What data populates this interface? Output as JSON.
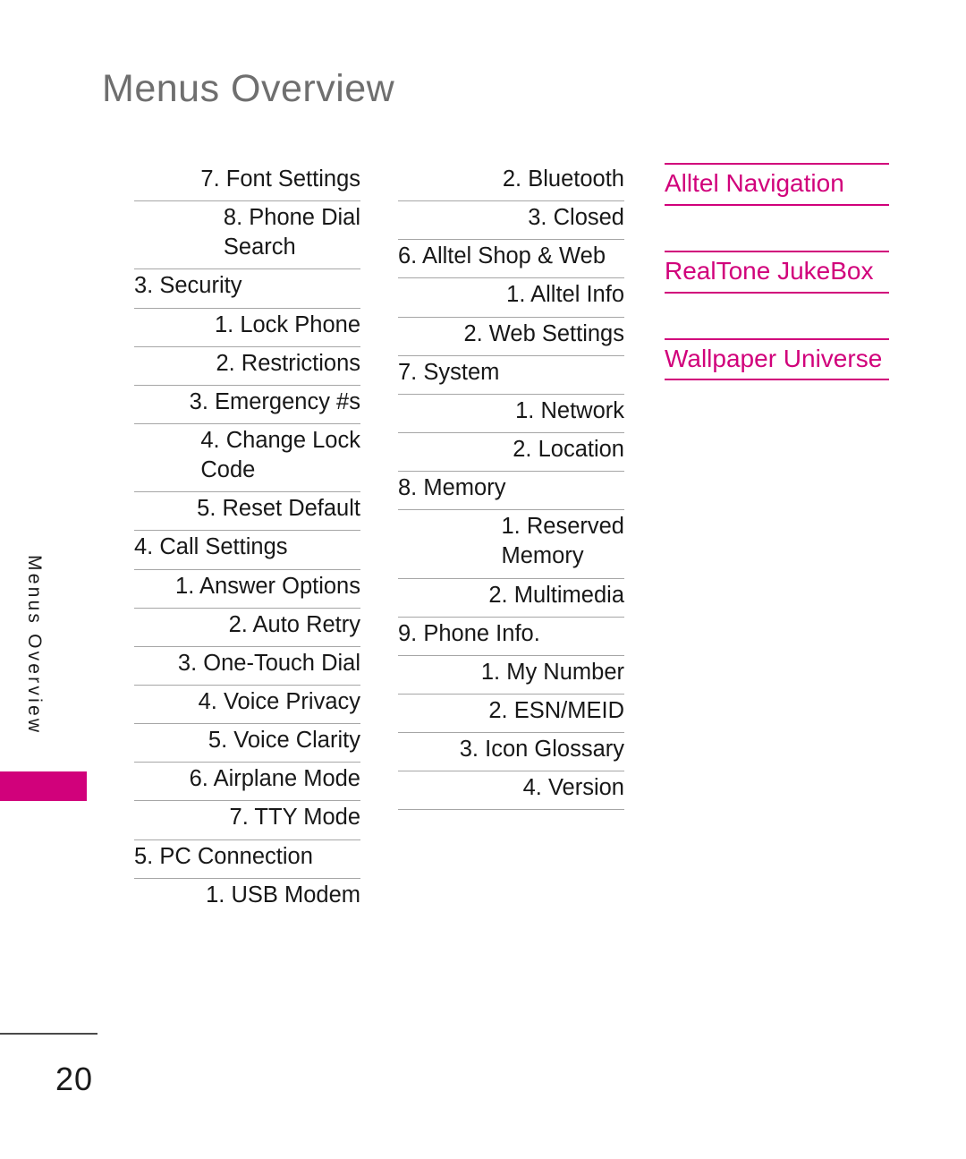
{
  "page": {
    "title": "Menus Overview",
    "side_tab_label": "Menus Overview",
    "page_number": "20",
    "accent_color": "#d1017b",
    "title_color": "#6f6f6f",
    "rule_color": "#a6a6a6"
  },
  "columns": [
    {
      "id": "column-1",
      "items": [
        {
          "num": "7. ",
          "text": "Font Settings",
          "level": 2
        },
        {
          "num": "8. ",
          "text": "Phone Dial\nSearch",
          "level": 2
        },
        {
          "num": "3. ",
          "text": "Security",
          "level": 1
        },
        {
          "num": "1. ",
          "text": "Lock Phone",
          "level": 2
        },
        {
          "num": "2. ",
          "text": "Restrictions",
          "level": 2
        },
        {
          "num": "3. ",
          "text": "Emergency #s",
          "level": 2
        },
        {
          "num": "4. ",
          "text": "Change Lock\nCode",
          "level": 2
        },
        {
          "num": "5. ",
          "text": "Reset Default",
          "level": 2
        },
        {
          "num": "4. ",
          "text": "Call Settings",
          "level": 1
        },
        {
          "num": "1. ",
          "text": "Answer Options",
          "level": 2
        },
        {
          "num": "2. ",
          "text": "Auto Retry",
          "level": 2
        },
        {
          "num": "3. ",
          "text": "One-Touch Dial",
          "level": 2
        },
        {
          "num": "4. ",
          "text": "Voice Privacy",
          "level": 2
        },
        {
          "num": "5. ",
          "text": "Voice Clarity",
          "level": 2
        },
        {
          "num": "6. ",
          "text": "Airplane Mode",
          "level": 2
        },
        {
          "num": "7. ",
          "text": "TTY Mode",
          "level": 2
        },
        {
          "num": "5. ",
          "text": "PC Connection",
          "level": 1
        },
        {
          "num": "1. ",
          "text": "USB Modem",
          "level": 2,
          "last": true
        }
      ]
    },
    {
      "id": "column-2",
      "items": [
        {
          "num": "2. ",
          "text": "Bluetooth",
          "level": 2
        },
        {
          "num": "3. ",
          "text": "Closed",
          "level": 2
        },
        {
          "num": "6. ",
          "text": "Alltel Shop & Web",
          "level": 1
        },
        {
          "num": "1. ",
          "text": "Alltel Info",
          "level": 2
        },
        {
          "num": "2. ",
          "text": "Web Settings",
          "level": 2
        },
        {
          "num": "7. ",
          "text": "System",
          "level": 1
        },
        {
          "num": "1. ",
          "text": "Network",
          "level": 2
        },
        {
          "num": "2. ",
          "text": "Location",
          "level": 2
        },
        {
          "num": "8. ",
          "text": "Memory",
          "level": 1
        },
        {
          "num": "1. ",
          "text": "Reserved\nMemory",
          "level": 2
        },
        {
          "num": "2. ",
          "text": "Multimedia",
          "level": 2
        },
        {
          "num": "9. ",
          "text": "Phone Info.",
          "level": 1
        },
        {
          "num": "1. ",
          "text": "My Number",
          "level": 2
        },
        {
          "num": "2. ",
          "text": "ESN/MEID",
          "level": 2
        },
        {
          "num": "3. ",
          "text": "Icon Glossary",
          "level": 2
        },
        {
          "num": "4. ",
          "text": "Version",
          "level": 2
        }
      ]
    }
  ],
  "features": [
    {
      "label": "Alltel Navigation"
    },
    {
      "label": "RealTone JukeBox"
    },
    {
      "label": "Wallpaper Universe"
    }
  ]
}
